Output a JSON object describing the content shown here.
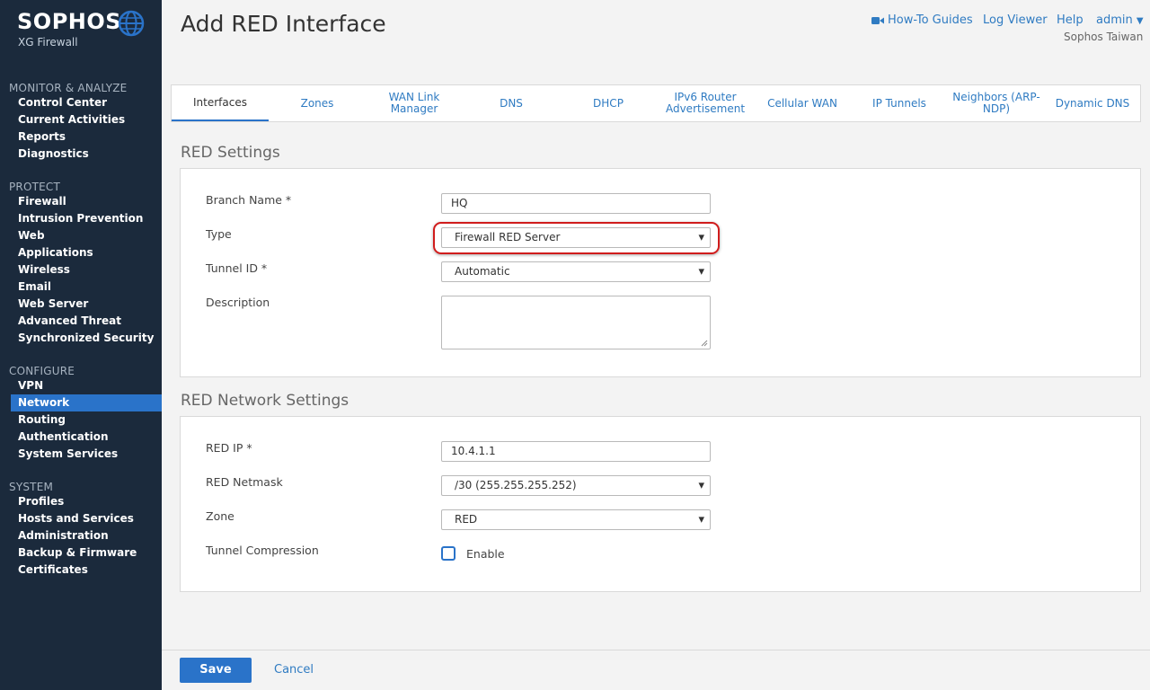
{
  "brand": {
    "name": "SOPHOS",
    "product": "XG Firewall",
    "accent_color": "#2a73c9",
    "sidebar_color": "#1b2a3c"
  },
  "sidebar": {
    "sections": [
      {
        "title": "MONITOR & ANALYZE",
        "items": [
          "Control Center",
          "Current Activities",
          "Reports",
          "Diagnostics"
        ]
      },
      {
        "title": "PROTECT",
        "items": [
          "Firewall",
          "Intrusion Prevention",
          "Web",
          "Applications",
          "Wireless",
          "Email",
          "Web Server",
          "Advanced Threat",
          "Synchronized Security"
        ]
      },
      {
        "title": "CONFIGURE",
        "items": [
          "VPN",
          "Network",
          "Routing",
          "Authentication",
          "System Services"
        ]
      },
      {
        "title": "SYSTEM",
        "items": [
          "Profiles",
          "Hosts and Services",
          "Administration",
          "Backup & Firmware",
          "Certificates"
        ]
      }
    ],
    "active_item": "Network"
  },
  "header": {
    "title": "Add RED Interface",
    "links": {
      "how_to": "How-To Guides",
      "log_viewer": "Log Viewer",
      "help": "Help",
      "admin": "admin"
    },
    "tenant": "Sophos Taiwan"
  },
  "tabs": [
    {
      "label": "Interfaces",
      "active": true
    },
    {
      "label": "Zones"
    },
    {
      "label": "WAN Link Manager"
    },
    {
      "label": "DNS"
    },
    {
      "label": "DHCP"
    },
    {
      "label": "IPv6 Router Advertisement"
    },
    {
      "label": "Cellular WAN"
    },
    {
      "label": "IP Tunnels"
    },
    {
      "label": "Neighbors (ARP-NDP)"
    },
    {
      "label": "Dynamic DNS"
    }
  ],
  "red_settings": {
    "title": "RED Settings",
    "branch_name": {
      "label": "Branch Name *",
      "value": "HQ"
    },
    "type": {
      "label": "Type",
      "value": "Firewall RED Server"
    },
    "tunnel_id": {
      "label": "Tunnel ID *",
      "value": "Automatic"
    },
    "description": {
      "label": "Description",
      "value": ""
    }
  },
  "red_network": {
    "title": "RED Network Settings",
    "red_ip": {
      "label": "RED IP *",
      "value": "10.4.1.1"
    },
    "netmask": {
      "label": "RED Netmask",
      "value": "/30 (255.255.255.252)"
    },
    "zone": {
      "label": "Zone",
      "value": "RED"
    },
    "compression": {
      "label": "Tunnel Compression",
      "checkbox_label": "Enable",
      "checked": false
    }
  },
  "footer": {
    "save": "Save",
    "cancel": "Cancel"
  },
  "icons": {
    "logo": "globe-icon",
    "how_to": "video-camera-icon",
    "admin_menu": "caret-down-icon",
    "select": "caret-down-icon"
  }
}
